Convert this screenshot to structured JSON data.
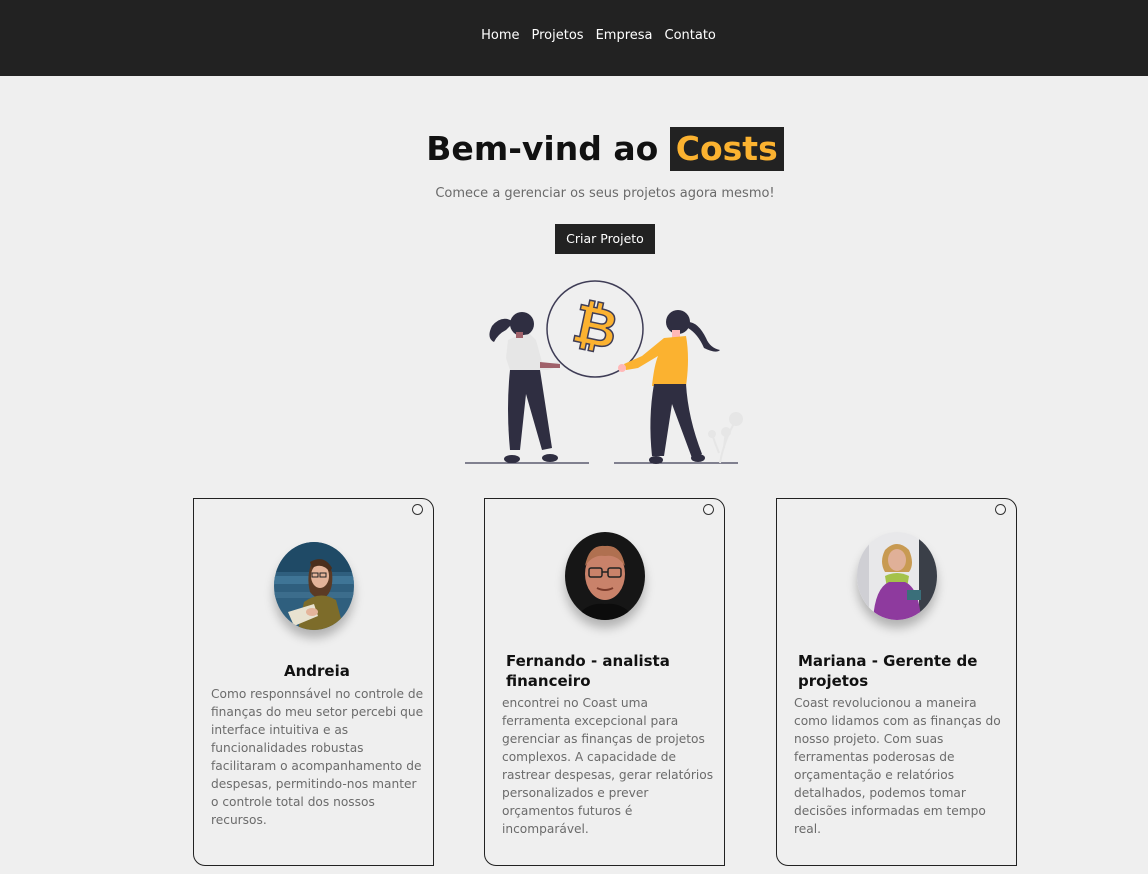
{
  "nav": {
    "items": [
      "Home",
      "Projetos",
      "Empresa",
      "Contato"
    ]
  },
  "hero": {
    "title_prefix": "Bem-vind ao",
    "title_brand": "Costs",
    "subtitle": "Comece a gerenciar os seus projetos agora mesmo!",
    "cta_label": "Criar Projeto"
  },
  "testimonials": [
    {
      "name": "Andreia",
      "text": "Como responnsável no controle de finanças do meu setor percebi que interface intuitiva e as funcionalidades robustas facilitaram o acompanhamento de despesas, permitindo-nos manter o controle total dos nossos recursos."
    },
    {
      "name": "Fernando - analista financeiro",
      "text": "encontrei no Coast uma ferramenta excepcional para gerenciar as finanças de projetos complexos. A capacidade de rastrear despesas, gerar relatórios personalizados e prever orçamentos futuros é incomparável."
    },
    {
      "name": "Mariana - Gerente de projetos",
      "text": "Coast revolucionou a maneira como lidamos com as finanças do nosso projeto. Com suas ferramentas poderosas de orçamentação e relatórios detalhados, podemos tomar decisões informadas em tempo real."
    }
  ],
  "colors": {
    "navbar": "#222222",
    "accent": "#fbb230",
    "background": "#efefef"
  }
}
